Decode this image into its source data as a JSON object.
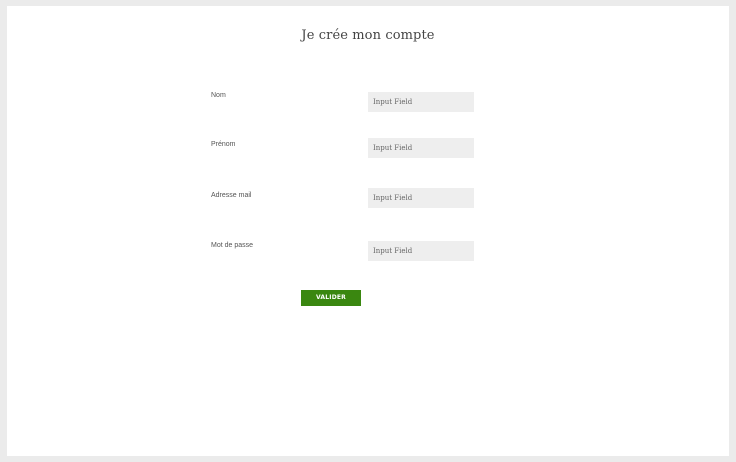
{
  "form": {
    "title": "Je crée mon compte",
    "fields": [
      {
        "label": "Nom",
        "placeholder": "Input Field",
        "value": ""
      },
      {
        "label": "Prénom",
        "placeholder": "Input Field",
        "value": ""
      },
      {
        "label": "Adresse mail",
        "placeholder": "Input Field",
        "value": ""
      },
      {
        "label": "Mot de passe",
        "placeholder": "Input Field",
        "value": ""
      }
    ],
    "submit_label": "VALIDER"
  },
  "colors": {
    "background": "#ebebeb",
    "panel": "#ffffff",
    "field_background": "#eeeeee",
    "button": "#3a8710",
    "button_text": "#ffffff"
  }
}
